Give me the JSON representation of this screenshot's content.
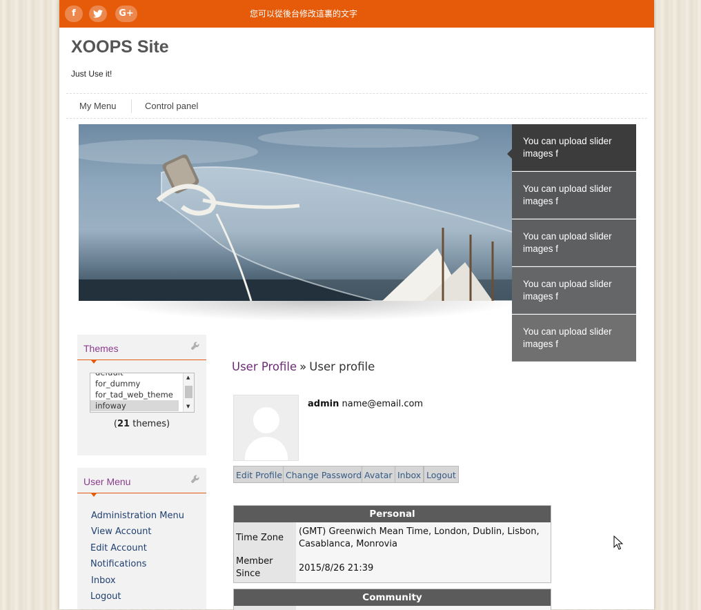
{
  "topbar": {
    "social": [
      {
        "icon": "facebook-icon",
        "glyph": "f"
      },
      {
        "icon": "twitter-icon",
        "glyph": "t"
      },
      {
        "icon": "google-plus-icon",
        "glyph": "G+"
      }
    ],
    "text": "您可以從後台修改這裏的文字",
    "color": "#e55b0a"
  },
  "header": {
    "title": "XOOPS Site",
    "slogan": "Just Use it!"
  },
  "nav": {
    "items": [
      "My Menu",
      "Control panel"
    ]
  },
  "slider": {
    "items": [
      "You can upload slider images f",
      "You can upload slider images f",
      "You can upload slider images f",
      "You can upload slider images f",
      "You can upload slider images f"
    ],
    "active_index": 0
  },
  "themes_block": {
    "title": "Themes",
    "options": [
      "default",
      "for_dummy",
      "for_tad_web_theme",
      "infoway"
    ],
    "selected": "infoway",
    "count_prefix": "(",
    "count": "21",
    "count_suffix": " themes)"
  },
  "user_menu": {
    "title": "User Menu",
    "items": [
      "Administration Menu",
      "View Account",
      "Edit Account",
      "Notifications",
      "Inbox",
      "Logout"
    ]
  },
  "main": {
    "breadcrumb": {
      "parent": "User Profile",
      "separator": "»",
      "current": "User profile"
    },
    "user": {
      "name": "admin",
      "email": "name@email.com"
    },
    "buttons": [
      "Edit Profile",
      "Change Password",
      "Avatar",
      "Inbox",
      "Logout"
    ],
    "personal": {
      "title": "Personal",
      "rows": [
        {
          "label": "Time Zone",
          "value": "(GMT) Greenwich Mean Time, London, Dublin, Lisbon, Casablanca, Monrovia"
        },
        {
          "label": "Member Since",
          "value": "2015/8/26 21:39"
        }
      ]
    },
    "community": {
      "title": "Community"
    }
  },
  "icons": {
    "wrench": "wrench-icon",
    "cursor": "mouse-cursor-icon"
  }
}
